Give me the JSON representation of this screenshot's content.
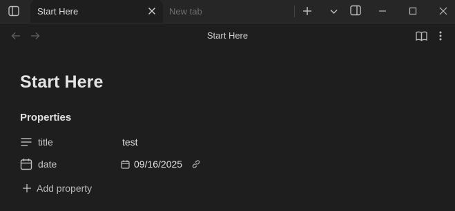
{
  "tabs": {
    "active_label": "Start Here",
    "inactive_label": "New tab"
  },
  "navbar": {
    "title": "Start Here"
  },
  "page": {
    "title": "Start Here",
    "properties_heading": "Properties",
    "properties": [
      {
        "name": "title",
        "value": "test",
        "icon": "lines-icon"
      },
      {
        "name": "date",
        "value": "09/16/2025",
        "icon": "calendar-icon"
      }
    ],
    "add_property_label": "Add property"
  },
  "colors": {
    "background": "#1e1e1e",
    "titlebar": "#262626",
    "text": "#dadada"
  }
}
